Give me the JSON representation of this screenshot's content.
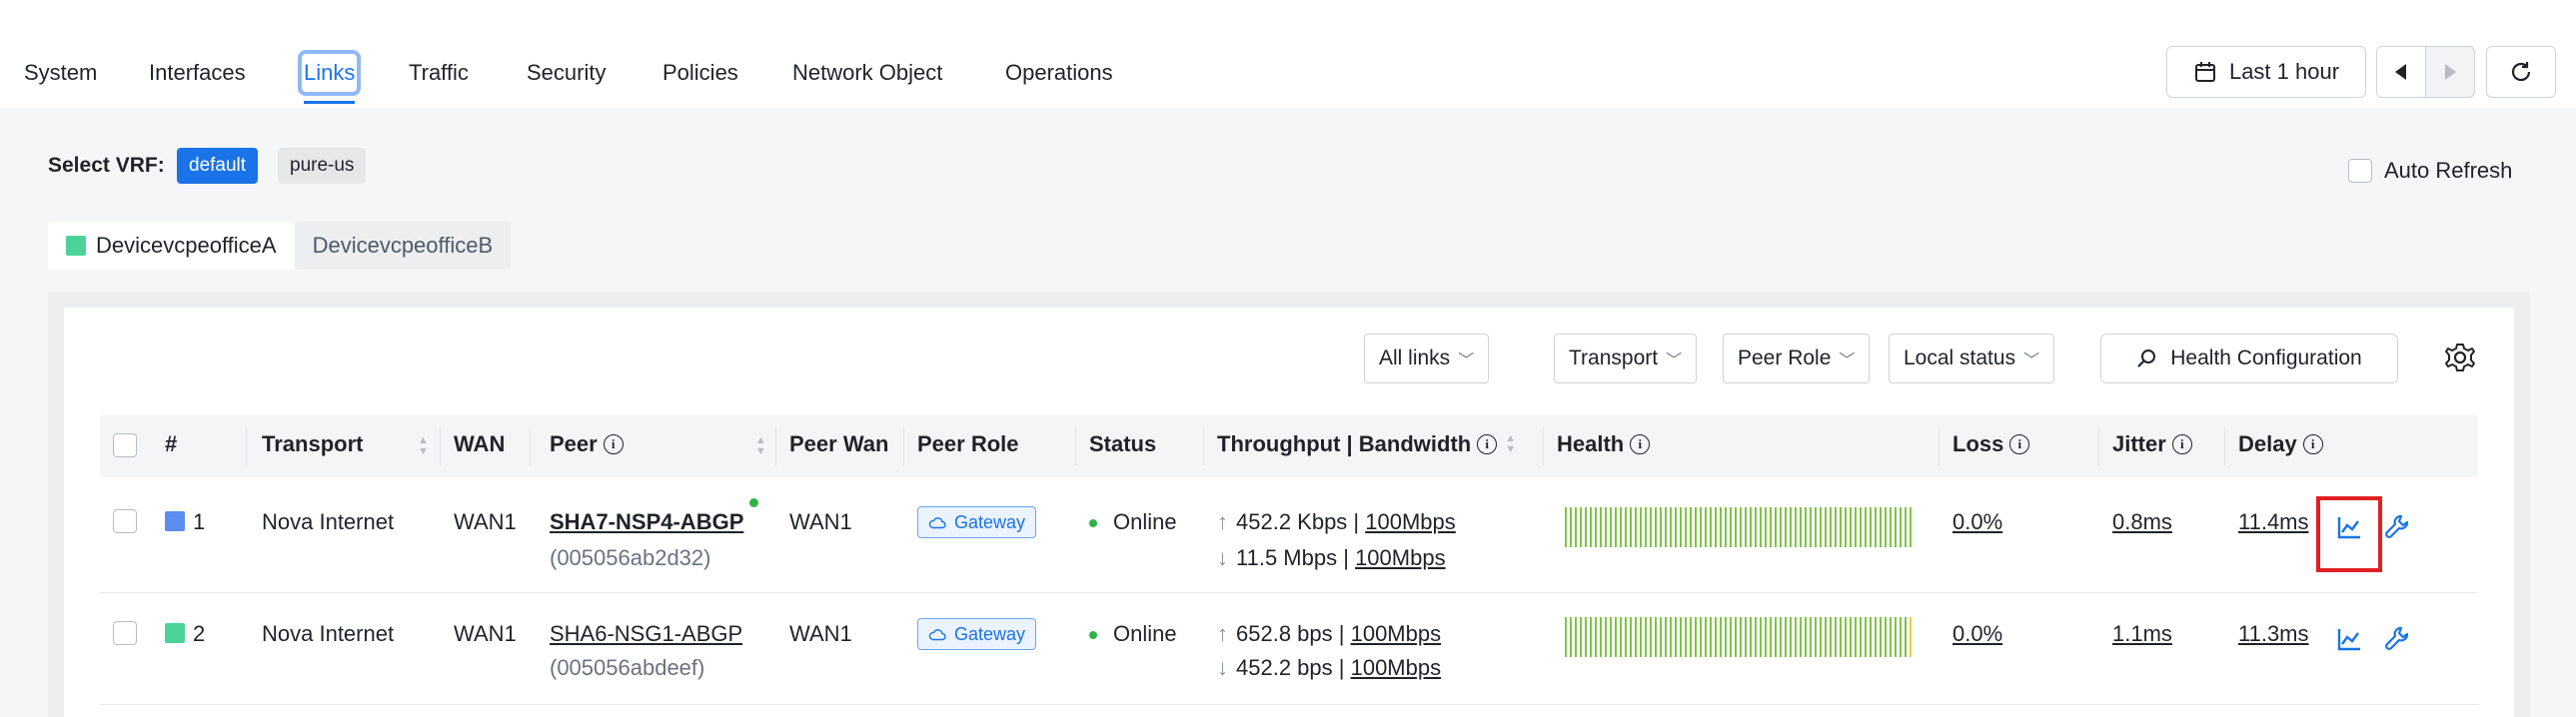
{
  "nav": {
    "tabs": [
      {
        "label": "System"
      },
      {
        "label": "Interfaces"
      },
      {
        "label": "Links"
      },
      {
        "label": "Traffic"
      },
      {
        "label": "Security"
      },
      {
        "label": "Policies"
      },
      {
        "label": "Network Object"
      },
      {
        "label": "Operations"
      }
    ],
    "active": "Links"
  },
  "toolbar": {
    "time_range": "Last 1 hour",
    "calendar_icon": "calendar-icon",
    "prev_icon": "triangle-left-icon",
    "next_icon": "triangle-right-icon",
    "refresh_icon": "refresh-icon"
  },
  "vrf": {
    "label": "Select VRF:",
    "options": [
      "default",
      "pure-us"
    ],
    "selected": "default"
  },
  "auto_refresh": {
    "label": "Auto Refresh",
    "checked": false
  },
  "devices": {
    "tabs": [
      {
        "label": "DevicevcpeofficeA",
        "color": "#4cd39a"
      },
      {
        "label": "DevicevcpeofficeB"
      }
    ],
    "active": "DevicevcpeofficeA"
  },
  "filters": {
    "all_links": "All links",
    "transport": "Transport",
    "peer_role": "Peer Role",
    "local_status": "Local status",
    "health_config": "Health Configuration"
  },
  "table": {
    "headers": {
      "num": "#",
      "transport": "Transport",
      "wan": "WAN",
      "peer": "Peer",
      "peer_wan": "Peer Wan",
      "peer_role": "Peer Role",
      "status": "Status",
      "throughput": "Throughput | Bandwidth",
      "health": "Health",
      "loss": "Loss",
      "jitter": "Jitter",
      "delay": "Delay"
    },
    "rows": [
      {
        "num": "1",
        "color": "#5b8def",
        "transport": "Nova Internet",
        "wan": "WAN1",
        "peer": "SHA7-NSP4-ABGP",
        "peer_id": "(005056ab2d32)",
        "peer_wan": "WAN1",
        "peer_role": "Gateway",
        "status": "Online",
        "up_rate": "452.2 Kbps",
        "up_bw": "100Mbps",
        "down_rate": "11.5 Mbps",
        "down_bw": "100Mbps",
        "loss": "0.0%",
        "jitter": "0.8ms",
        "delay": "11.4ms"
      },
      {
        "num": "2",
        "color": "#4cd39a",
        "transport": "Nova Internet",
        "wan": "WAN1",
        "peer": "SHA6-NSG1-ABGP",
        "peer_id": "(005056abdeef)",
        "peer_wan": "WAN1",
        "peer_role": "Gateway",
        "status": "Online",
        "up_rate": "652.8 bps",
        "up_bw": "100Mbps",
        "down_rate": "452.2 bps",
        "down_bw": "100Mbps",
        "loss": "0.0%",
        "jitter": "1.1ms",
        "delay": "11.3ms"
      }
    ]
  },
  "colors": {
    "accent": "#1a73e8",
    "health_good": "#7ec447",
    "health_warn": "#f2c94c",
    "online": "#2fb344"
  }
}
